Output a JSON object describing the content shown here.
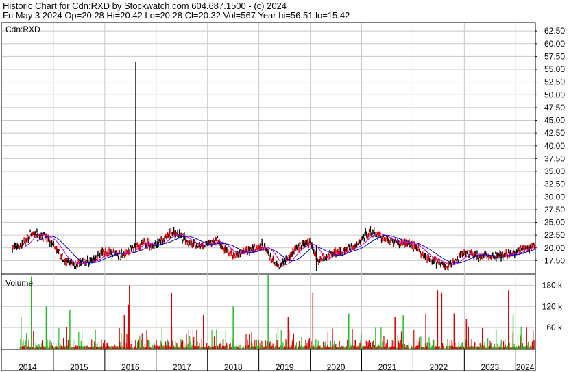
{
  "header": {
    "line1": "Historic Chart for Cdn:RXD by Stockwatch.com 604.687.1500 - (c) 2024",
    "line2": "Fri May  3 2024   Op=20.28  Hi=20.42  Lo=20.28  Cl=20.32  Vol=567  Year hi=56.51  lo=15.42"
  },
  "colors": {
    "up": "#dd0000",
    "down": "#000000",
    "ma_short": "#cc00cc",
    "ma_long": "#0000cc",
    "vol_up": "#22bb22",
    "vol_down": "#dd0000",
    "grid": "#c8c8c8"
  },
  "chart_data": [
    {
      "type": "line",
      "title": "Cdn:RXD",
      "price_ticks": [
        "62.50",
        "60.00",
        "57.50",
        "55.00",
        "52.50",
        "50.00",
        "47.50",
        "45.00",
        "42.50",
        "40.00",
        "37.50",
        "35.00",
        "32.50",
        "30.00",
        "27.50",
        "25.00",
        "22.50",
        "20.00",
        "17.50"
      ],
      "ylim": [
        15,
        64
      ],
      "x_years": [
        "2014",
        "2015",
        "2016",
        "2017",
        "2018",
        "2019",
        "2020",
        "2021",
        "2022",
        "2023",
        "2024"
      ],
      "x_range": [
        2014.0,
        2024.37
      ],
      "grid": true,
      "series": [
        {
          "x": [
            2014.2,
            2014.4,
            2014.55,
            2014.7,
            2014.85,
            2015.0,
            2015.15,
            2015.3,
            2015.45,
            2015.6,
            2015.75,
            2015.9,
            2016.05,
            2016.2,
            2016.35,
            2016.5,
            2016.65,
            2016.8,
            2016.9,
            2017.0,
            2017.15,
            2017.3,
            2017.45,
            2017.6,
            2017.75,
            2017.9,
            2018.05,
            2018.2,
            2018.35,
            2018.5,
            2018.65,
            2018.8,
            2018.95,
            2019.1,
            2019.25,
            2019.4,
            2019.55,
            2019.7,
            2019.85,
            2020.0,
            2020.1,
            2020.15,
            2020.3,
            2020.45,
            2020.6,
            2020.75,
            2020.9,
            2021.05,
            2021.2,
            2021.35,
            2021.5,
            2021.65,
            2021.8,
            2021.95,
            2022.1,
            2022.25,
            2022.4,
            2022.55,
            2022.7,
            2022.85,
            2023.0,
            2023.15,
            2023.3,
            2023.45,
            2023.6,
            2023.75,
            2023.9,
            2024.05,
            2024.2,
            2024.33
          ],
          "values": [
            20.0,
            20.5,
            22.5,
            22.8,
            22.0,
            20.5,
            18.0,
            17.0,
            16.8,
            17.2,
            17.5,
            18.8,
            19.2,
            19.0,
            18.5,
            19.5,
            20.5,
            21.0,
            20.5,
            20.8,
            21.5,
            23.0,
            22.5,
            21.5,
            20.5,
            20.2,
            21.0,
            21.2,
            19.5,
            18.5,
            19.0,
            19.5,
            20.2,
            20.5,
            17.5,
            16.0,
            18.0,
            19.5,
            20.5,
            21.0,
            19.0,
            17.5,
            18.5,
            19.0,
            19.2,
            20.0,
            20.2,
            22.5,
            23.0,
            22.5,
            21.5,
            21.2,
            21.0,
            20.8,
            19.8,
            18.0,
            17.5,
            16.8,
            16.5,
            17.5,
            19.0,
            18.8,
            18.2,
            18.5,
            18.2,
            18.5,
            19.0,
            19.5,
            19.8,
            20.3
          ]
        }
      ]
    },
    {
      "type": "bar",
      "title": "Volume",
      "vol_ticks": [
        "180 k",
        "120 k",
        "60 k"
      ],
      "ylim": [
        0,
        210000
      ],
      "spikes": [
        {
          "x": 2014.37,
          "value": 90000,
          "dir": "up"
        },
        {
          "x": 2014.57,
          "value": 205000,
          "dir": "up"
        },
        {
          "x": 2014.86,
          "value": 120000,
          "dir": "up"
        },
        {
          "x": 2015.32,
          "value": 110000,
          "dir": "up"
        },
        {
          "x": 2016.38,
          "value": 95000,
          "dir": "down"
        },
        {
          "x": 2016.48,
          "value": 180000,
          "dir": "down"
        },
        {
          "x": 2016.46,
          "value": 125000,
          "dir": "down"
        },
        {
          "x": 2017.3,
          "value": 160000,
          "dir": "down"
        },
        {
          "x": 2017.92,
          "value": 95000,
          "dir": "down"
        },
        {
          "x": 2018.5,
          "value": 120000,
          "dir": "up"
        },
        {
          "x": 2019.18,
          "value": 220000,
          "dir": "up"
        },
        {
          "x": 2019.57,
          "value": 90000,
          "dir": "down"
        },
        {
          "x": 2020.05,
          "value": 160000,
          "dir": "down"
        },
        {
          "x": 2020.75,
          "value": 100000,
          "dir": "up"
        },
        {
          "x": 2021.65,
          "value": 90000,
          "dir": "down"
        },
        {
          "x": 2021.81,
          "value": 95000,
          "dir": "up"
        },
        {
          "x": 2022.25,
          "value": 100000,
          "dir": "down"
        },
        {
          "x": 2022.48,
          "value": 165000,
          "dir": "down"
        },
        {
          "x": 2022.56,
          "value": 160000,
          "dir": "down"
        },
        {
          "x": 2022.8,
          "value": 100000,
          "dir": "down"
        },
        {
          "x": 2023.04,
          "value": 85000,
          "dir": "down"
        },
        {
          "x": 2023.86,
          "value": 165000,
          "dir": "down"
        },
        {
          "x": 2023.95,
          "value": 95000,
          "dir": "up"
        }
      ]
    }
  ]
}
